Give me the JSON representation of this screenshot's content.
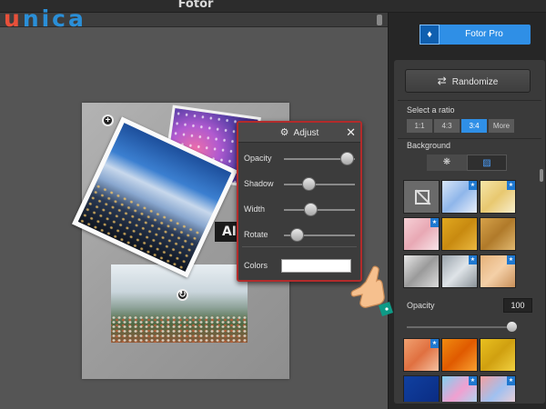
{
  "watermark": {
    "first": "u",
    "rest": "nica"
  },
  "app": {
    "title": "Fotor"
  },
  "photos": {
    "sign_text": "AI"
  },
  "adjust": {
    "title": "Adjust",
    "close": "✕",
    "rows": [
      {
        "label": "Opacity",
        "level": 0.9
      },
      {
        "label": "Shadow",
        "level": 0.3
      },
      {
        "label": "Width",
        "level": 0.32
      },
      {
        "label": "Rotate",
        "level": 0.1
      }
    ],
    "colors_label": "Colors",
    "color_value": "#ffffff"
  },
  "panel": {
    "pro_label": "Fotor Pro",
    "randomize_label": "Randomize",
    "ratio_title": "Select a ratio",
    "ratios": [
      "1:1",
      "4:3",
      "3:4",
      "More"
    ],
    "ratio_selected": "3:4",
    "background_title": "Background",
    "opacity_label": "Opacity",
    "opacity_value": "100",
    "opacity_level": 1.0
  },
  "colors": {
    "accent": "#2f8fe6",
    "dialog_border": "#b32b2b",
    "panel_bg": "#262626"
  },
  "icons": [
    "diamond-icon",
    "shuffle-icon",
    "gear-icon",
    "close-icon",
    "pattern-icon",
    "stripes-icon",
    "no-image-icon",
    "premium-star-icon",
    "hand-pointer-icon"
  ]
}
